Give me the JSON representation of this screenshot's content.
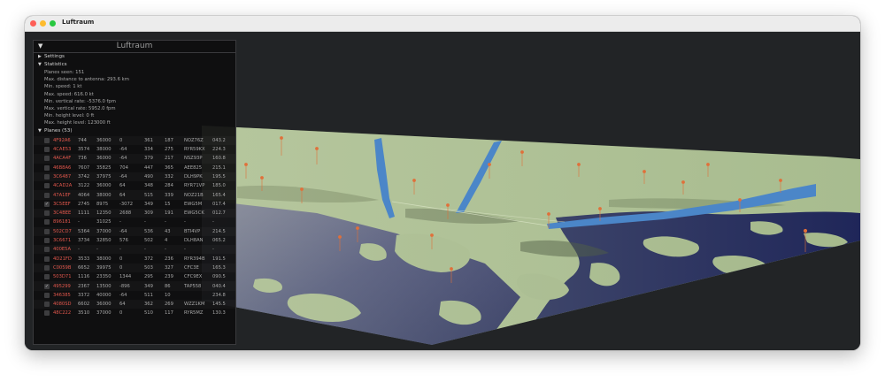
{
  "window": {
    "title": "Luftraum"
  },
  "panel": {
    "title": "Luftraum",
    "collapse_glyph": "▼",
    "settings_label": "Settings",
    "statistics_label": "Statistics",
    "stats": [
      "Planes seen: 151",
      "Max. distance to antenna: 293.6 km",
      "Min. speed: 1 kt",
      "Max. speed: 616.0 kt",
      "Min. vertical rate: -5376.0 fpm",
      "Max. vertical rate: 5952.0 fpm",
      "Min. height level: 0 ft",
      "Max. height level: 123000 ft"
    ],
    "planes_label": "Planes (53)",
    "planes": [
      {
        "checked": false,
        "cols": [
          "4F92A6",
          "744",
          "36000",
          "0",
          "361",
          "187",
          "NOZ76Z",
          "043.2"
        ]
      },
      {
        "checked": false,
        "cols": [
          "4CAE53",
          "3574",
          "38000",
          "-64",
          "334",
          "275",
          "RYR59KX",
          "224.3"
        ]
      },
      {
        "checked": false,
        "cols": [
          "4ACA4F",
          "736",
          "36000",
          "-64",
          "379",
          "217",
          "NSZ93P",
          "160.8"
        ]
      },
      {
        "checked": false,
        "cols": [
          "46B8A6",
          "7607",
          "35825",
          "704",
          "447",
          "365",
          "AEE825",
          "215.1"
        ]
      },
      {
        "checked": false,
        "cols": [
          "3C6487",
          "3742",
          "37975",
          "-64",
          "490",
          "332",
          "DLH9PK",
          "195.5"
        ]
      },
      {
        "checked": false,
        "cols": [
          "4CAD2A",
          "3122",
          "36000",
          "64",
          "348",
          "284",
          "RYR71VP",
          "185.0"
        ]
      },
      {
        "checked": false,
        "cols": [
          "47A1EF",
          "4064",
          "38000",
          "64",
          "515",
          "339",
          "NOZ21B",
          "165.4"
        ]
      },
      {
        "checked": true,
        "cols": [
          "3C5EEF",
          "2745",
          "8975",
          "-3072",
          "349",
          "15",
          "EWG5M",
          "017.4"
        ]
      },
      {
        "checked": false,
        "cols": [
          "3C4BEE",
          "1111",
          "12350",
          "2688",
          "309",
          "191",
          "EWG5CK",
          "012.7"
        ]
      },
      {
        "checked": false,
        "cols": [
          "896181",
          "-",
          "31025",
          "-",
          "-",
          "-",
          "-",
          "-"
        ]
      },
      {
        "checked": false,
        "cols": [
          "502CD7",
          "5364",
          "37000",
          "-64",
          "536",
          "43",
          "BTI4VP",
          "214.5"
        ]
      },
      {
        "checked": false,
        "cols": [
          "3C6671",
          "3734",
          "32850",
          "576",
          "502",
          "4",
          "DLH8AN",
          "065.2"
        ]
      },
      {
        "checked": false,
        "cols": [
          "400E5A",
          "-",
          "-",
          "-",
          "-",
          "-",
          "-",
          "-"
        ]
      },
      {
        "checked": false,
        "cols": [
          "4D21FD",
          "3533",
          "38000",
          "0",
          "372",
          "236",
          "RYR394B",
          "191.5"
        ]
      },
      {
        "checked": false,
        "cols": [
          "C0059B",
          "6652",
          "39975",
          "0",
          "503",
          "327",
          "CFC3E",
          "165.3"
        ]
      },
      {
        "checked": false,
        "cols": [
          "503D71",
          "1116",
          "23350",
          "1344",
          "295",
          "239",
          "CFC9EX",
          "090.5"
        ]
      },
      {
        "checked": true,
        "cols": [
          "495299",
          "2367",
          "13500",
          "-896",
          "349",
          "86",
          "TAP558",
          "040.4"
        ]
      },
      {
        "checked": false,
        "cols": [
          "346385",
          "3372",
          "40000",
          "-64",
          "511",
          "10",
          "",
          "234.8"
        ]
      },
      {
        "checked": false,
        "cols": [
          "4080SD",
          "6602",
          "36000",
          "64",
          "362",
          "269",
          "WZZ1KM",
          "145.5"
        ]
      },
      {
        "checked": false,
        "cols": [
          "48C222",
          "3510",
          "37000",
          "0",
          "510",
          "117",
          "RYR5MZ",
          "130.3"
        ]
      }
    ]
  },
  "colors": {
    "land": "#a7bb8f",
    "water": "#22285a",
    "track": "#4b86c8",
    "marker": "#e0703a",
    "hex_text": "#e2574c"
  }
}
